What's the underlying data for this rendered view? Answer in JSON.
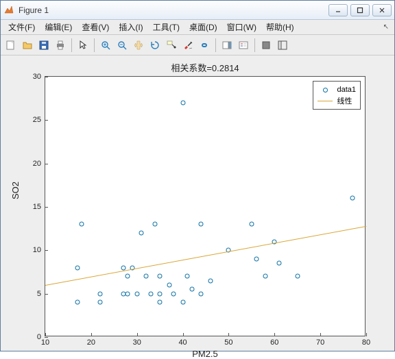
{
  "window": {
    "title": "Figure 1"
  },
  "menu": {
    "file": "文件(F)",
    "edit": "编辑(E)",
    "view": "查看(V)",
    "insert": "插入(I)",
    "tools": "工具(T)",
    "desktop": "桌面(D)",
    "window": "窗口(W)",
    "help": "帮助(H)"
  },
  "chart_data": {
    "type": "scatter",
    "title": "相关系数=0.2814",
    "xlabel": "PM2.5",
    "ylabel": "SO2",
    "xlim": [
      10,
      80
    ],
    "ylim": [
      0,
      30
    ],
    "xticks": [
      10,
      20,
      30,
      40,
      50,
      60,
      70,
      80
    ],
    "yticks": [
      0,
      5,
      10,
      15,
      20,
      25,
      30
    ],
    "series": [
      {
        "name": "data1",
        "type": "scatter",
        "x": [
          17,
          17,
          18,
          22,
          22,
          27,
          27,
          28,
          28,
          29,
          30,
          31,
          32,
          33,
          34,
          35,
          35,
          35,
          37,
          38,
          40,
          40,
          41,
          42,
          44,
          44,
          46,
          50,
          55,
          56,
          58,
          60,
          61,
          65,
          77
        ],
        "y": [
          8,
          4,
          13,
          4,
          5,
          8,
          5,
          7,
          5,
          8,
          5,
          12,
          7,
          5,
          13,
          5,
          7,
          4,
          6,
          5,
          4,
          27,
          7,
          5.5,
          13,
          5,
          6.5,
          10,
          13,
          9,
          7,
          11,
          8.5,
          7,
          16
        ]
      },
      {
        "name": "线性",
        "type": "line",
        "x": [
          10,
          80
        ],
        "y": [
          6.0,
          12.8
        ]
      }
    ]
  },
  "legend": {
    "data1": "data1",
    "fit": "线性"
  }
}
